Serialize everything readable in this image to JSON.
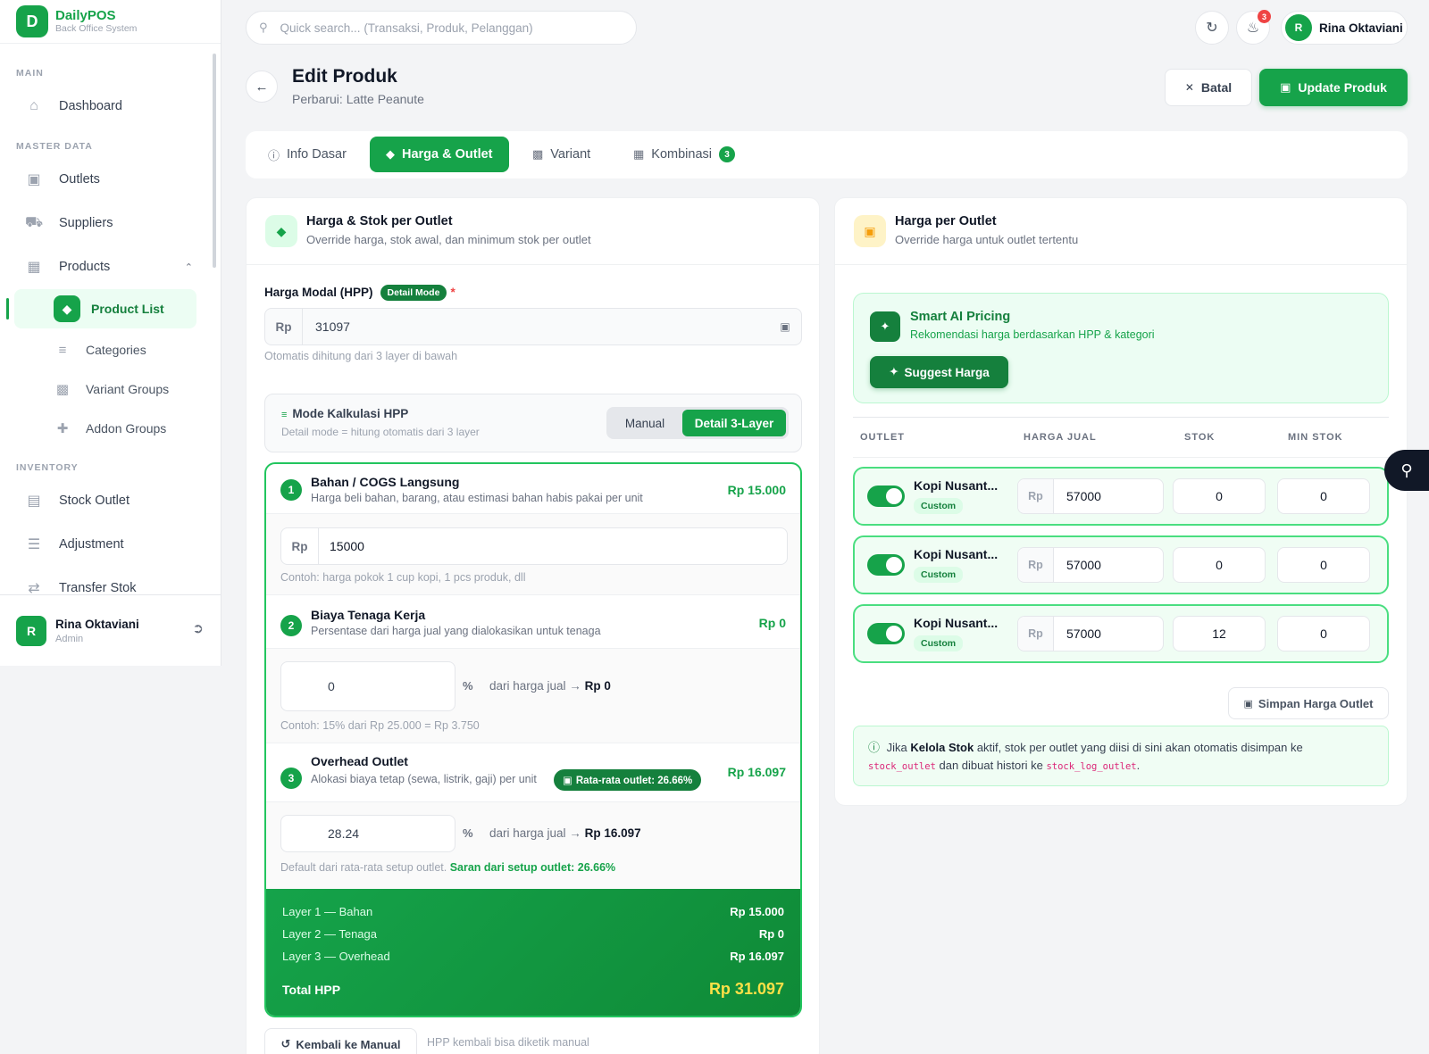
{
  "brand": {
    "name": "DailyPOS",
    "sub": "Back Office System",
    "logo": "D"
  },
  "sidebar": {
    "sections": {
      "main": "MAIN",
      "master": "MASTER DATA",
      "inventory": "INVENTORY"
    },
    "dashboard": "Dashboard",
    "outlets": "Outlets",
    "suppliers": "Suppliers",
    "products": "Products",
    "product_list": "Product List",
    "categories": "Categories",
    "variant_groups": "Variant Groups",
    "addon_groups": "Addon Groups",
    "stock_outlet": "Stock Outlet",
    "adjustment": "Adjustment",
    "transfer_stok": "Transfer Stok",
    "user": {
      "initial": "R",
      "name": "Rina Oktaviani",
      "role": "Admin"
    }
  },
  "topbar": {
    "search_placeholder": "Quick search... (Transaksi, Produk, Pelanggan)",
    "notif_count": "3",
    "user_initial": "R",
    "user_name": "Rina Oktaviani"
  },
  "page": {
    "title": "Edit Produk",
    "subtitle": "Perbarui: Latte Peanute",
    "cancel": "Batal",
    "update": "Update Produk"
  },
  "tabs": [
    {
      "label": "Info Dasar",
      "icon": "info-icon"
    },
    {
      "label": "Harga & Outlet",
      "icon": "tag-icon"
    },
    {
      "label": "Variant",
      "icon": "variant-icon"
    },
    {
      "label": "Kombinasi",
      "icon": "grid-icon",
      "count": "3"
    }
  ],
  "left": {
    "title": "Harga & Stok per Outlet",
    "subtitle": "Override harga, stok awal, dan minimum stok per outlet",
    "hpp_label": "Harga Modal (HPP)",
    "hpp_mode": "Detail Mode",
    "hpp_required": "*",
    "currency": "Rp",
    "hpp_value": "31097",
    "hpp_hint": "Otomatis dihitung dari 3 layer di bawah",
    "calc_title": "Mode Kalkulasi HPP",
    "calc_sub": "Detail mode = hitung otomatis dari 3 layer",
    "seg_manual": "Manual",
    "seg_detail": "Detail 3-Layer",
    "layer1": {
      "num": "1",
      "title": "Bahan / COGS Langsung",
      "sub": "Harga beli bahan, barang, atau estimasi bahan habis pakai per unit",
      "amount": "Rp 15.000",
      "value": "15000",
      "hint": "Contoh: harga pokok 1 cup kopi, 1 pcs produk, dll"
    },
    "layer2": {
      "num": "2",
      "title": "Biaya Tenaga Kerja",
      "sub": "Persentase dari harga jual yang dialokasikan untuk tenaga",
      "amount": "Rp 0",
      "value": "0",
      "pct": "%",
      "note": "dari harga jual →",
      "note_val": "Rp 0",
      "hint": "Contoh: 15% dari Rp 25.000 = Rp 3.750"
    },
    "layer3": {
      "num": "3",
      "title": "Overhead Outlet",
      "sub": "Alokasi biaya tetap (sewa, listrik, gaji) per unit",
      "avg": "Rata-rata outlet: 26.66%",
      "amount": "Rp 16.097",
      "value": "28.24",
      "pct": "%",
      "note": "dari harga jual →",
      "note_val": "Rp 16.097",
      "hint": "Default dari rata-rata setup outlet.",
      "hint_sugg": "Saran dari setup outlet: 26.66%"
    },
    "summary": {
      "rows": [
        {
          "label": "Layer 1 — Bahan",
          "value": "Rp 15.000"
        },
        {
          "label": "Layer 2 — Tenaga",
          "value": "Rp 0"
        },
        {
          "label": "Layer 3 — Overhead",
          "value": "Rp 16.097"
        }
      ],
      "total_label": "Total HPP",
      "total_value": "Rp 31.097"
    },
    "back_manual": "Kembali ke Manual",
    "back_manual_hint": "HPP kembali bisa diketik manual"
  },
  "right": {
    "title": "Harga per Outlet",
    "subtitle": "Override harga untuk outlet tertentu",
    "ai_title": "Smart AI Pricing",
    "ai_sub": "Rekomendasi harga berdasarkan HPP & kategori",
    "suggest": "Suggest Harga",
    "headers": {
      "outlet": "OUTLET",
      "price": "HARGA JUAL",
      "stock": "STOK",
      "min": "MIN STOK"
    },
    "rows": [
      {
        "name": "Kopi Nusant...",
        "tag": "Custom",
        "cur": "Rp",
        "price": "57000",
        "stock": "0",
        "min": "0",
        "enabled": true
      },
      {
        "name": "Kopi Nusant...",
        "tag": "Custom",
        "cur": "Rp",
        "price": "57000",
        "stock": "0",
        "min": "0",
        "enabled": true
      },
      {
        "name": "Kopi Nusant...",
        "tag": "Custom",
        "cur": "Rp",
        "price": "57000",
        "stock": "12",
        "min": "0",
        "enabled": true
      }
    ],
    "save": "Simpan Harga Outlet",
    "info": {
      "t1": "Jika",
      "b1": "Kelola Stok",
      "t2": "aktif, stok per outlet yang diisi di sini akan otomatis disimpan ke",
      "c1": "stock_outlet",
      "t3": "dan dibuat histori ke",
      "c2": "stock_log_outlet",
      "t4": "."
    }
  },
  "colors": {
    "primary": "#16a34a",
    "primary_dark": "#15803d",
    "danger": "#ef4444",
    "highlight": "#fde047"
  }
}
